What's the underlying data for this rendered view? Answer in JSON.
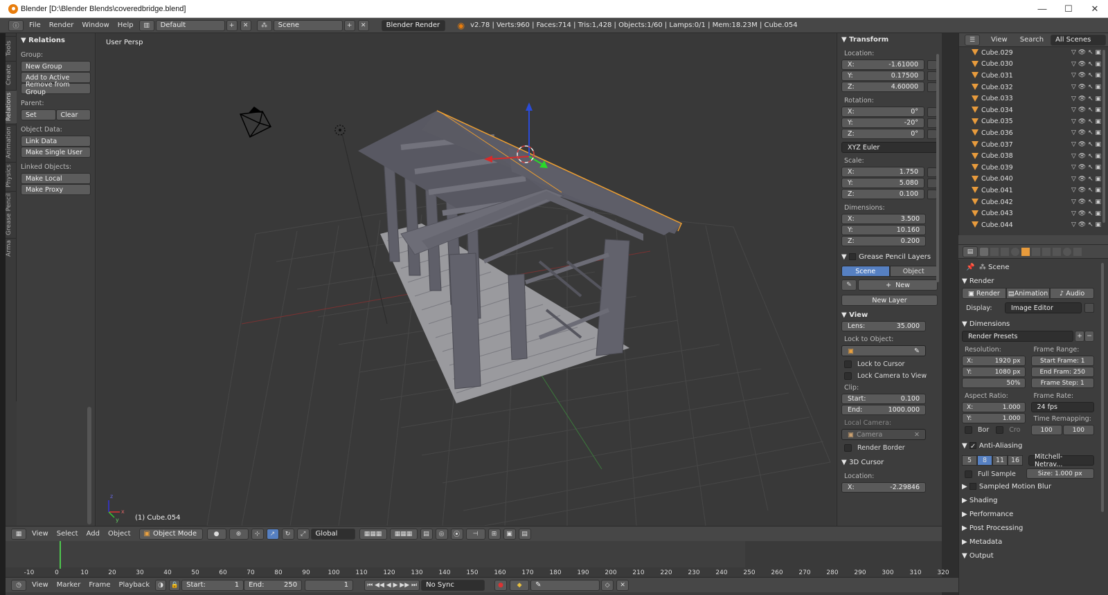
{
  "window": {
    "title": "Blender [D:\\Blender Blends\\coveredbridge.blend]",
    "minimize": "—",
    "maximize": "☐",
    "close": "✕"
  },
  "topbar": {
    "menus": [
      "File",
      "Render",
      "Window",
      "Help"
    ],
    "layout": "Default",
    "scene": "Scene",
    "engine": "Blender Render",
    "stats": "v2.78 | Verts:960 | Faces:714 | Tris:1,428 | Objects:1/60 | Lamps:0/1 | Mem:18.23M | Cube.054"
  },
  "tool_tabs": [
    "Tools",
    "Create",
    "Relations",
    "Animation",
    "Physics",
    "Grease Pencil",
    "Arma"
  ],
  "shelf": {
    "panel": "Relations",
    "group_label": "Group:",
    "new_group": "New Group",
    "add_active": "Add to Active",
    "remove_from_group": "Remove from Group",
    "parent_label": "Parent:",
    "set": "Set",
    "clear": "Clear",
    "object_data_label": "Object Data:",
    "link_data": "Link Data",
    "make_single_user": "Make Single User",
    "linked_objects_label": "Linked Objects:",
    "make_local": "Make Local",
    "make_proxy": "Make Proxy"
  },
  "viewport": {
    "view_label": "User Persp",
    "object_label": "(1) Cube.054",
    "axis_x": "x",
    "axis_y": "y",
    "axis_z": "z"
  },
  "npanel": {
    "transform": "Transform",
    "location_label": "Location:",
    "location": {
      "x": "-1.61000",
      "y": "0.17500",
      "z": "4.60000"
    },
    "rotation_label": "Rotation:",
    "rotation": {
      "x": "0°",
      "y": "-20°",
      "z": "0°"
    },
    "rot_mode": "XYZ Euler",
    "scale_label": "Scale:",
    "scale": {
      "x": "1.750",
      "y": "5.080",
      "z": "0.100"
    },
    "dimensions_label": "Dimensions:",
    "dimensions": {
      "x": "3.500",
      "y": "10.160",
      "z": "0.200"
    },
    "gp_layers": "Grease Pencil Layers",
    "gp_scene": "Scene",
    "gp_object": "Object",
    "gp_new": "New",
    "gp_new_layer": "New Layer",
    "view": "View",
    "lens_label": "Lens:",
    "lens": "35.000",
    "lock_object_label": "Lock to Object:",
    "lock_cursor": "Lock to Cursor",
    "lock_camera": "Lock Camera to View",
    "clip_label": "Clip:",
    "clip_start_label": "Start:",
    "clip_start": "0.100",
    "clip_end_label": "End:",
    "clip_end": "1000.000",
    "local_camera_label": "Local Camera:",
    "camera": "Camera",
    "render_border": "Render Border",
    "cursor3d": "3D Cursor",
    "cursor_location_label": "Location:",
    "cursor_x": "-2.29846"
  },
  "outliner": {
    "view": "View",
    "search": "Search",
    "filter": "All Scenes",
    "items": [
      "Cube.029",
      "Cube.030",
      "Cube.031",
      "Cube.032",
      "Cube.033",
      "Cube.034",
      "Cube.035",
      "Cube.036",
      "Cube.037",
      "Cube.038",
      "Cube.039",
      "Cube.040",
      "Cube.041",
      "Cube.042",
      "Cube.043",
      "Cube.044"
    ]
  },
  "properties": {
    "scene": "Scene",
    "render": "Render",
    "render_btn": "Render",
    "animation_btn": "Animation",
    "audio_btn": "Audio",
    "display_label": "Display:",
    "display": "Image Editor",
    "dimensions": "Dimensions",
    "presets": "Render Presets",
    "resolution_label": "Resolution:",
    "res_x": "1920 px",
    "res_y": "1080 px",
    "res_pct": "50%",
    "frame_range_label": "Frame Range:",
    "start_frame": "Start Frame: 1",
    "end_frame": "End Fram: 250",
    "frame_step": "Frame Step: 1",
    "aspect_label": "Aspect Ratio:",
    "aspect_x": "1.000",
    "aspect_y": "1.000",
    "frame_rate_label": "Frame Rate:",
    "fps": "24 fps",
    "time_remap_label": "Time Remapping:",
    "remap_old": "100",
    "remap_new": "100",
    "bor": "Bor",
    "cro": "Cro",
    "anti_aliasing": "Anti-Aliasing",
    "aa_samples": [
      "5",
      "8",
      "11",
      "16"
    ],
    "filter": "Mitchell-Netrav...",
    "full_sample": "Full Sample",
    "size": "Size: 1.000 px",
    "motion_blur": "Sampled Motion Blur",
    "shading": "Shading",
    "performance": "Performance",
    "post_processing": "Post Processing",
    "metadata": "Metadata",
    "output": "Output"
  },
  "view_header": {
    "menus": [
      "View",
      "Select",
      "Add",
      "Object"
    ],
    "mode": "Object Mode",
    "orientation": "Global"
  },
  "timeline": {
    "ticks": [
      "-10",
      "0",
      "10",
      "20",
      "30",
      "40",
      "50",
      "60",
      "70",
      "80",
      "90",
      "100",
      "110",
      "120",
      "130",
      "140",
      "150",
      "160",
      "170",
      "180",
      "190",
      "200",
      "210",
      "220",
      "230",
      "240",
      "250",
      "260",
      "270",
      "280",
      "290",
      "300",
      "310",
      "320"
    ],
    "menus": [
      "View",
      "Marker",
      "Frame",
      "Playback"
    ],
    "start_label": "Start:",
    "start": "1",
    "end_label": "End:",
    "end": "250",
    "current": "1",
    "sync": "No Sync"
  }
}
